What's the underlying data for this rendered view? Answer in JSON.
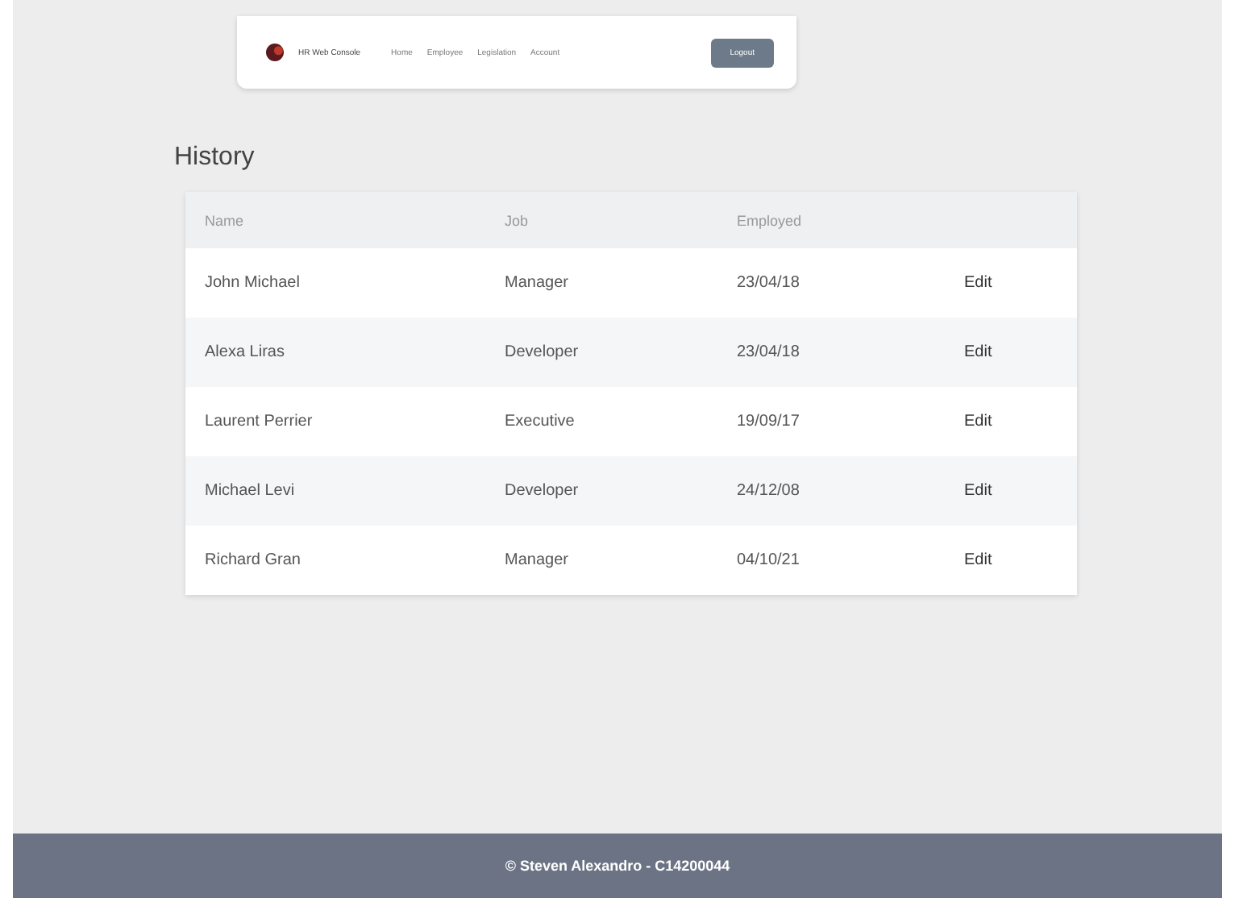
{
  "navbar": {
    "brand": "HR Web Console",
    "links": [
      {
        "label": "Home"
      },
      {
        "label": "Employee"
      },
      {
        "label": "Legislation"
      },
      {
        "label": "Account"
      }
    ],
    "button": "Logout"
  },
  "history": {
    "title": "History",
    "columns": [
      "Name",
      "Job",
      "Employed"
    ],
    "rows": [
      {
        "name": "John Michael",
        "job": "Manager",
        "employed": "23/04/18",
        "action": "Edit"
      },
      {
        "name": "Alexa Liras",
        "job": "Developer",
        "employed": "23/04/18",
        "action": "Edit"
      },
      {
        "name": "Laurent Perrier",
        "job": "Executive",
        "employed": "19/09/17",
        "action": "Edit"
      },
      {
        "name": "Michael Levi",
        "job": "Developer",
        "employed": "24/12/08",
        "action": "Edit"
      },
      {
        "name": "Richard Gran",
        "job": "Manager",
        "employed": "04/10/21",
        "action": "Edit"
      }
    ]
  },
  "footer": "© Steven Alexandro - C14200044"
}
